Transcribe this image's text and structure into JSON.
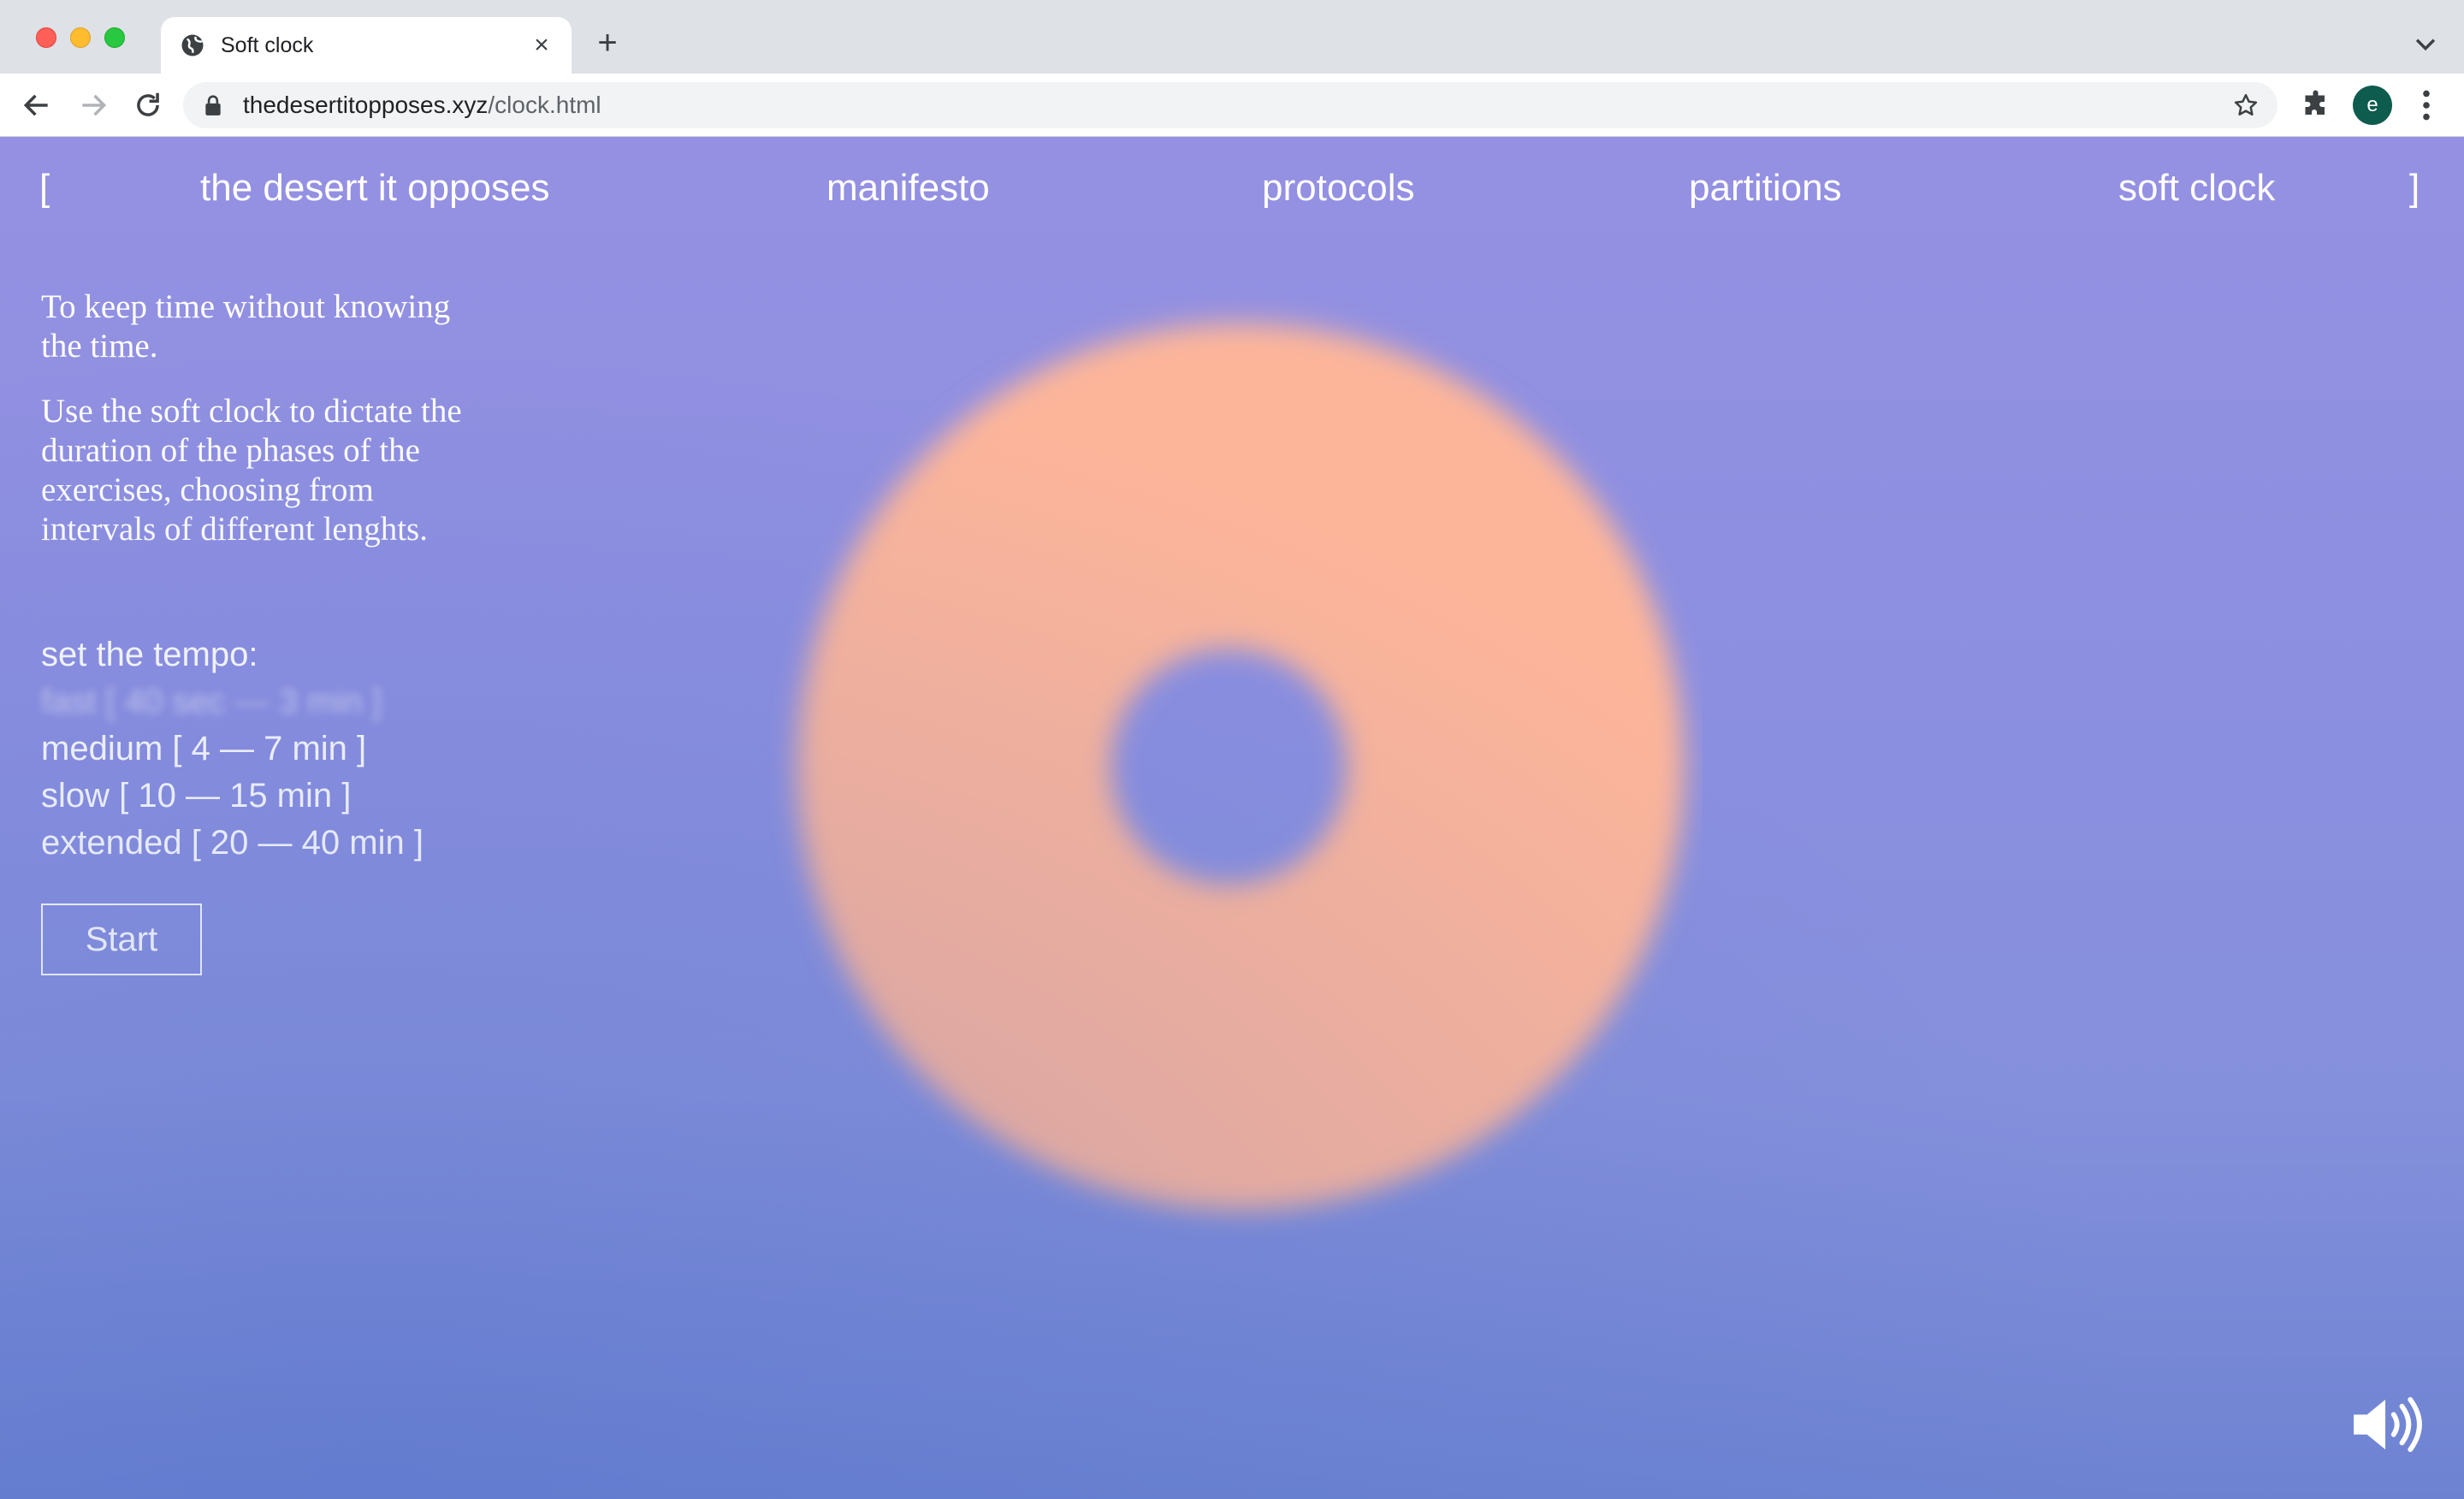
{
  "browser": {
    "tab_title": "Soft clock",
    "url_host": "thedesertitopposes.xyz",
    "url_path": "/clock.html",
    "profile_initial": "e"
  },
  "nav": {
    "bracket_open": "[",
    "items": [
      "the desert it opposes",
      "manifesto",
      "protocols",
      "partitions",
      "soft clock"
    ],
    "bracket_close": "]"
  },
  "intro": {
    "line1": "To keep time without knowing the time.",
    "line2": "Use the soft clock to dictate the duration of the phases of the exercises, choosing from intervals of different lenghts."
  },
  "tempo": {
    "label": "set the tempo:",
    "options": [
      "fast [ 40 sec — 3 min ]",
      "medium [ 4 — 7 min ]",
      "slow [ 10 — 15 min ]",
      "extended [ 20 — 40 min ]"
    ]
  },
  "start_label": "Start",
  "colors": {
    "ring": "#fdb59a",
    "background_top": "#9590e2",
    "background_bottom": "#6d83d2"
  }
}
